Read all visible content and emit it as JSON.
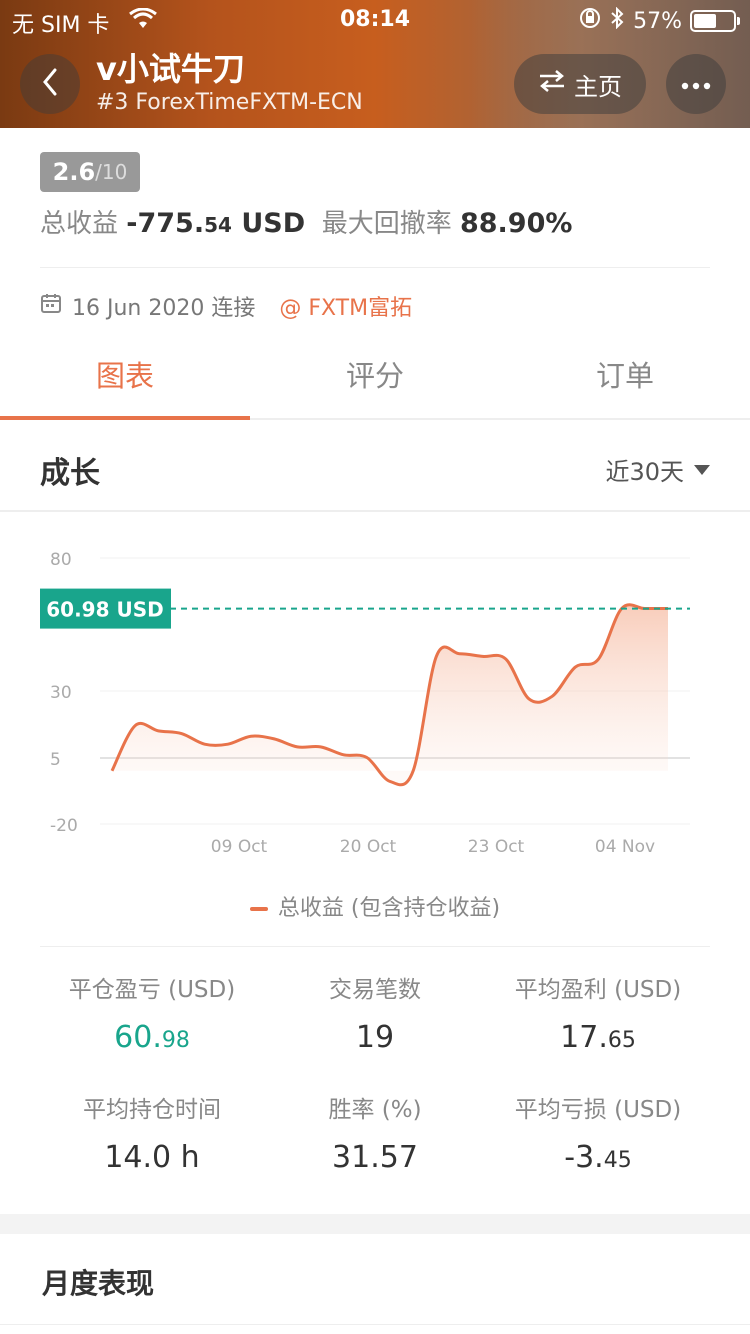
{
  "status_bar": {
    "carrier": "无 SIM 卡",
    "time": "08:14",
    "battery": "57%",
    "battery_level": 0.57
  },
  "header": {
    "title": "v小试牛刀",
    "subtitle": "#3 ForexTimeFXTM-ECN",
    "home_label": "主页"
  },
  "summary": {
    "score": "2.6",
    "score_max": "/10",
    "total_profit_label": "总收益",
    "total_profit_main": "-775.",
    "total_profit_dec": "54",
    "total_profit_unit": "USD",
    "drawdown_label": "最大回撤率",
    "drawdown_value": "88.90%",
    "connect_date": "16 Jun 2020 连接",
    "broker": "FXTM富拓"
  },
  "tabs": [
    {
      "label": "图表"
    },
    {
      "label": "评分"
    },
    {
      "label": "订单"
    }
  ],
  "section": {
    "title": "成长",
    "range": "近30天"
  },
  "chart_data": {
    "type": "area",
    "y_ticks": [
      "80",
      "30",
      "5",
      "-20"
    ],
    "y_range": [
      -20,
      80
    ],
    "x_ticks": [
      "09 Oct",
      "20 Oct",
      "23 Oct",
      "04 Nov"
    ],
    "current_label": "60.98 USD",
    "current_value": 60.98,
    "series": [
      {
        "name": "总收益 (包含持仓收益)",
        "values": [
          0,
          17,
          15,
          14,
          10,
          10,
          13,
          12,
          9,
          9,
          6,
          5,
          -4,
          0,
          43,
          44,
          43,
          42,
          27,
          28,
          39,
          42,
          61,
          61,
          61
        ]
      }
    ],
    "line_color": "#e8734a"
  },
  "legend": {
    "label": "总收益 (包含持仓收益)"
  },
  "metrics": [
    {
      "label": "平仓盈亏 (USD)",
      "int": "60.",
      "dec": "98",
      "green": true
    },
    {
      "label": "交易笔数",
      "int": "19",
      "dec": "",
      "green": false
    },
    {
      "label": "平均盈利 (USD)",
      "int": "17.",
      "dec": "65",
      "green": false
    },
    {
      "label": "平均持仓时间",
      "int": "14.0 h",
      "dec": "",
      "green": false
    },
    {
      "label": "胜率 (%)",
      "int": "31.57",
      "dec": "",
      "green": false
    },
    {
      "label": "平均亏损 (USD)",
      "int": "-3.",
      "dec": "45",
      "green": false
    }
  ],
  "monthly": {
    "title": "月度表现"
  }
}
